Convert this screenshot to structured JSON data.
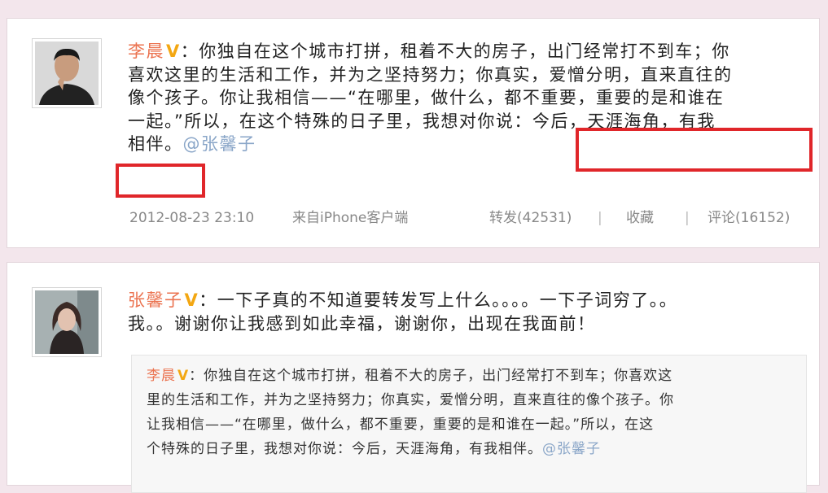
{
  "post1": {
    "author": "李晨",
    "badge": "V",
    "lines": [
      "：你独自在这个城市打拼，租着不大的房子，出门经常打不到车；你",
      "喜欢这里的生活和工作，并为之坚持努力；你真实，爱憎分明，直来直往的",
      "像个孩子。你让我相信——“在哪里，做什么，都不重要，重要的是和谁在",
      "一起。”所以，在这个特殊的日子里，我想对你说：今后，天涯海角，有我"
    ],
    "line5_text": "相伴。",
    "mention": "@张馨子",
    "time": "2012-08-23 23:10",
    "source": "来自iPhone客户端",
    "forward": "转发(42531)",
    "separator": "|",
    "favorite": "收藏",
    "comment": "评论(16152)"
  },
  "post2": {
    "author": "张馨子",
    "badge": "V",
    "line1": "：一下子真的不知道要转发写上什么。。。。一下子词穷了。。",
    "line2": "我。。谢谢你让我感到如此幸福，谢谢你，出现在我面前！",
    "quote": {
      "author": "李晨",
      "badge": "V",
      "line1": "：你独自在这个城市打拼，租着不大的房子，出门经常打不到车；你喜欢这",
      "line2": "里的生活和工作，并为之坚持努力；你真实，爱憎分明，直来直往的像个孩子。你",
      "line3": "让我相信——“在哪里，做什么，都不重要，重要的是和谁在一起。”所以，在这",
      "line4": "个特殊的日子里，我想对你说：今后，天涯海角，有我相伴。",
      "mention": "@张馨子"
    }
  },
  "colors": {
    "author": "#eb7350",
    "mention": "#8aa6c8",
    "highlight_box": "#e0262a",
    "verified_badge": "#f3a712"
  }
}
